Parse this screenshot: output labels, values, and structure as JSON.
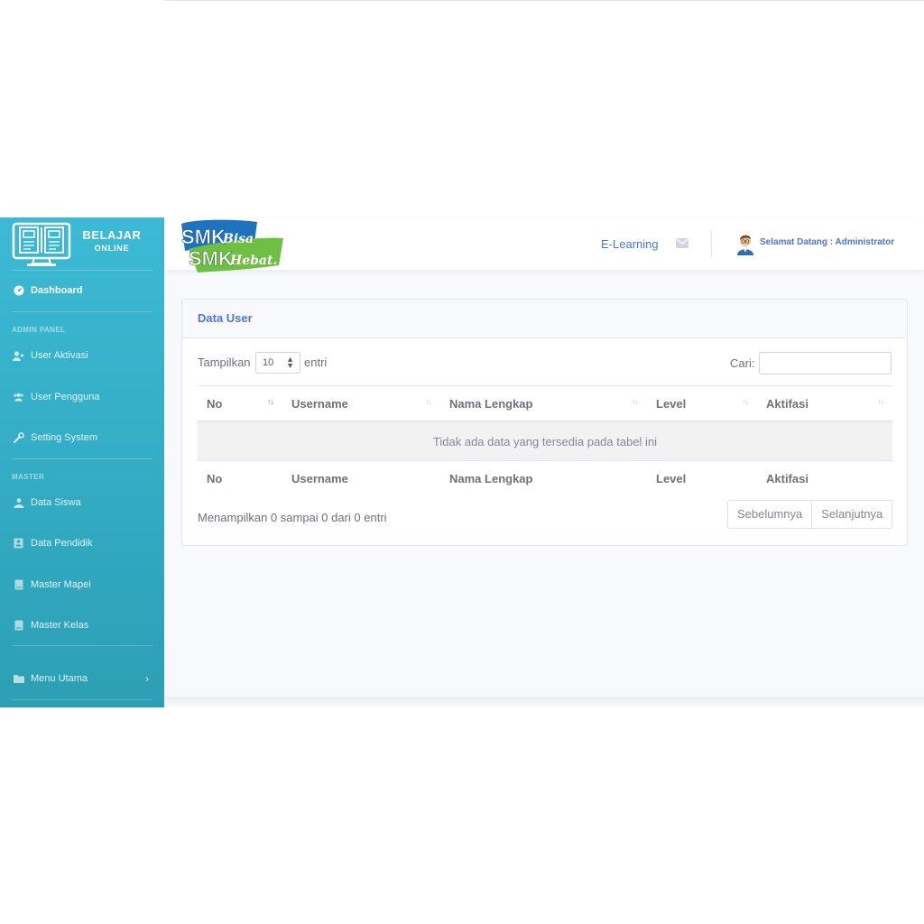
{
  "sidebar": {
    "brand_title": "BELAJAR",
    "brand_subtitle": "ONLINE",
    "dashboard": "Dashboard",
    "heading_admin": "ADMIN PANEL",
    "heading_master": "MASTER",
    "items": [
      {
        "label": "User Aktivasi",
        "icon": "user-plus-icon"
      },
      {
        "label": "User Pengguna",
        "icon": "users-icon"
      },
      {
        "label": "Setting System",
        "icon": "wrench-icon"
      },
      {
        "label": "Data Siswa",
        "icon": "user-tie-icon"
      },
      {
        "label": "Data Pendidik",
        "icon": "id-card-icon"
      },
      {
        "label": "Master Mapel",
        "icon": "book-icon"
      },
      {
        "label": "Master Kelas",
        "icon": "book-icon"
      },
      {
        "label": "Menu Utama",
        "icon": "folder-icon"
      }
    ]
  },
  "topbar": {
    "logo_line1": "SMK",
    "logo_line1_script": "Bisa",
    "logo_line2": "SMK",
    "logo_line2_script": "Hebat.",
    "elearning": "E-Learning",
    "welcome": "Selamat Datang : Administrator"
  },
  "card": {
    "title": "Data User",
    "show_label": "Tampilkan",
    "page_size": "10",
    "entries_label": "entri",
    "search_label": "Cari:",
    "search_value": "",
    "columns": [
      "No",
      "Username",
      "Nama Lengkap",
      "Level",
      "Aktifasi"
    ],
    "empty_message": "Tidak ada data yang tersedia pada tabel ini",
    "info": "Menampilkan 0 sampai 0 dari 0 entri",
    "prev": "Sebelumnya",
    "next": "Selanjutnya"
  },
  "colors": {
    "sidebar_top": "#3cbad5",
    "sidebar_bottom": "#2c9fb4",
    "accent": "#4e73df",
    "logo_blue": "#1e73be",
    "logo_green": "#6fbf44"
  }
}
